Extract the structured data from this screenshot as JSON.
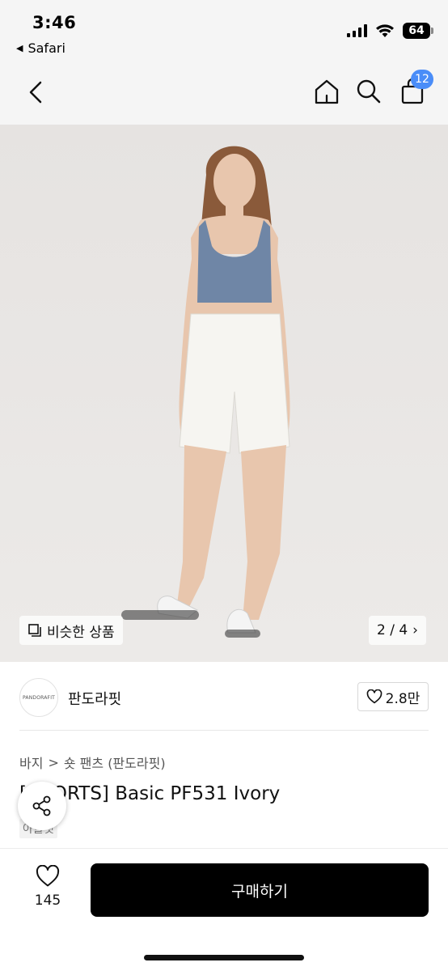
{
  "status": {
    "time": "3:46",
    "back_app": "Safari",
    "battery": "64"
  },
  "nav": {
    "cart_count": "12"
  },
  "hero": {
    "similar_label": "비슷한 상품",
    "page_indicator": "2 / 4",
    "colors": {
      "top": "#6f86a6",
      "shorts": "#f6f5f1",
      "skin": "#e8c6ad",
      "hair": "#8a5a3a"
    }
  },
  "brand": {
    "logo_text": "PANDORAFIT",
    "name": "판도라핏",
    "likes": "2.8만"
  },
  "breadcrumb": {
    "category": "바지",
    "separator": ">",
    "subcategory": "숏 팬츠 (판도라핏)"
  },
  "product": {
    "title": "[SHORTS] Basic PF531 Ivory",
    "sub_tag": "아울렛"
  },
  "bottom": {
    "wish_count": "145",
    "buy_label": "구매하기"
  }
}
